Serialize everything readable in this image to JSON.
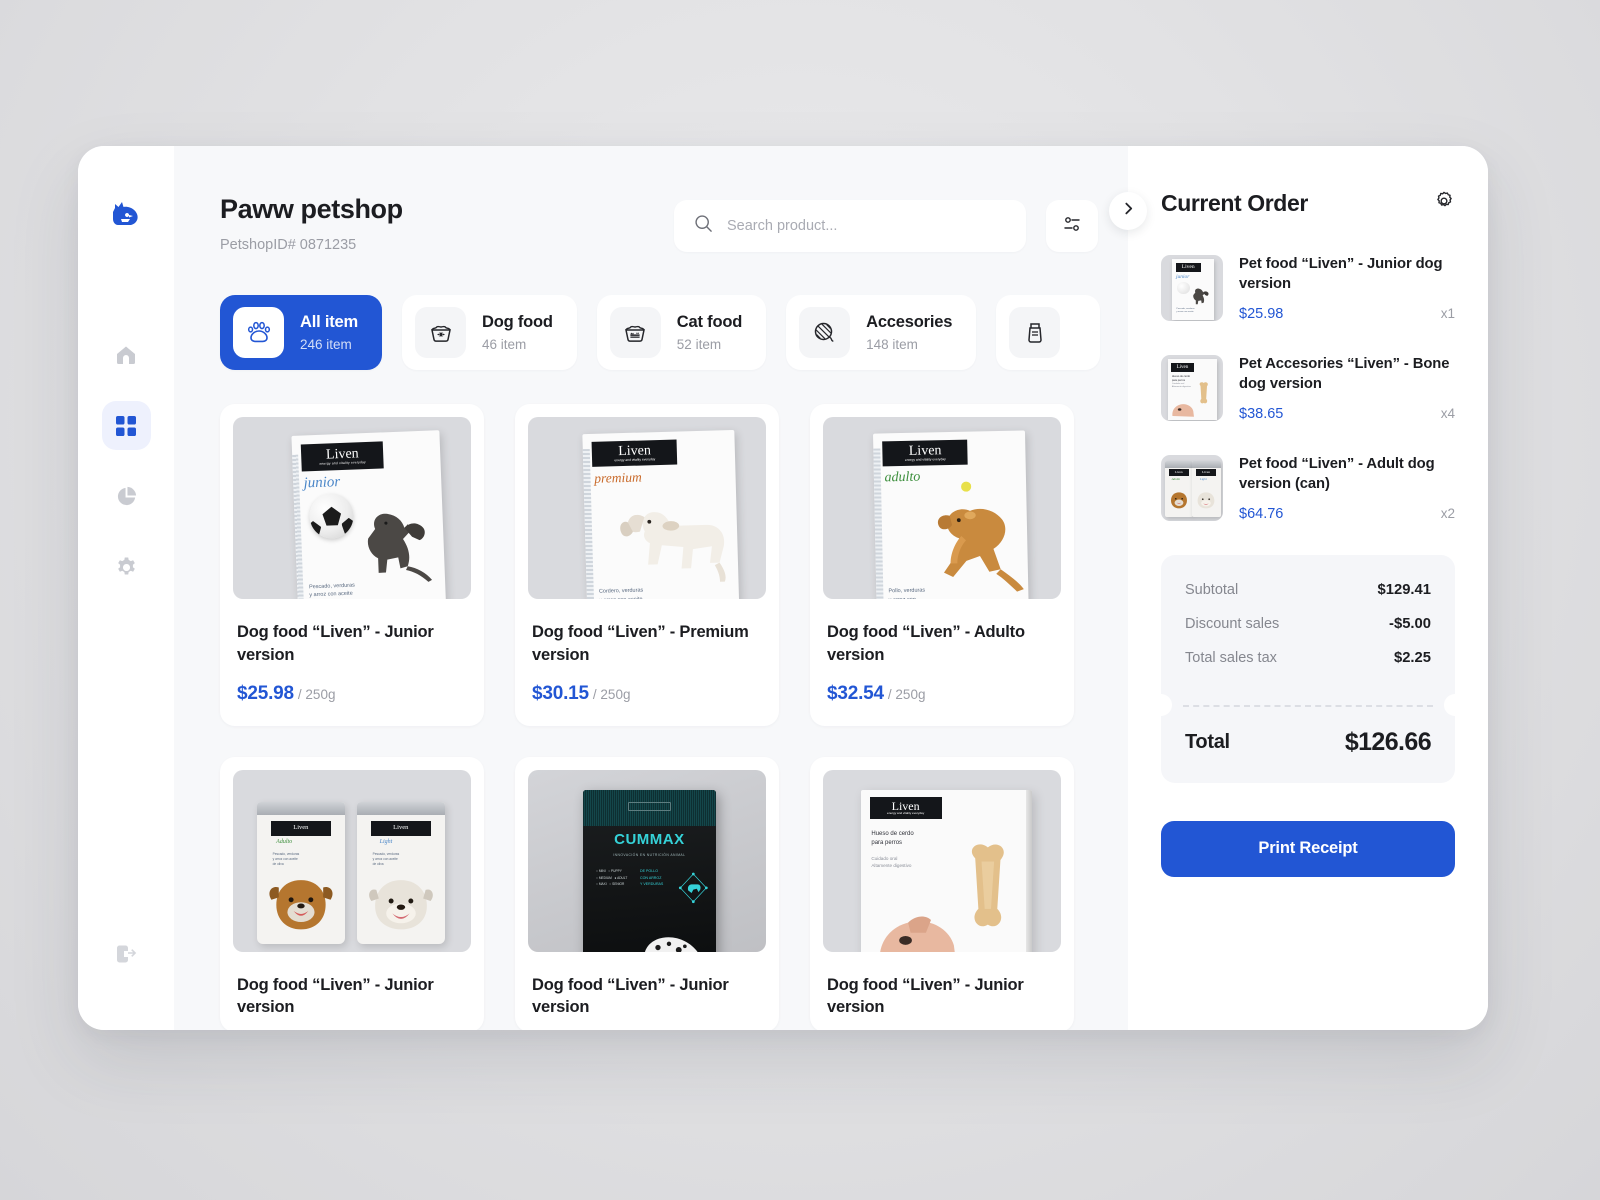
{
  "app": {
    "logo_icon": "dog-head-logo",
    "accent_color": "#2256d4",
    "background_color": "#f7f8fa"
  },
  "sidebar": {
    "items": [
      {
        "name": "home",
        "icon": "home-icon",
        "active": false
      },
      {
        "name": "dashboard",
        "icon": "grid-icon",
        "active": true
      },
      {
        "name": "analytics",
        "icon": "pie-chart-icon",
        "active": false
      },
      {
        "name": "settings",
        "icon": "gear-icon",
        "active": false
      }
    ],
    "logout": {
      "name": "logout",
      "icon": "logout-icon"
    }
  },
  "header": {
    "title": "Paww petshop",
    "subtitle": "PetshopID# 0871235",
    "search": {
      "placeholder": "Search product...",
      "value": "",
      "icon": "search-icon"
    },
    "filter_button": {
      "icon": "filter-sliders-icon"
    }
  },
  "categories": [
    {
      "label": "All item",
      "count": "246 item",
      "icon": "paw-icon",
      "active": true
    },
    {
      "label": "Dog food",
      "count": "46 item",
      "icon": "dog-bowl-icon",
      "active": false
    },
    {
      "label": "Cat food",
      "count": "52 item",
      "icon": "cat-bowl-icon",
      "active": false
    },
    {
      "label": "Accesories",
      "count": "148 item",
      "icon": "yarn-ball-icon",
      "active": false
    },
    {
      "label": "",
      "count": "",
      "icon": "grooming-bottle-icon",
      "active": false
    }
  ],
  "products": [
    {
      "title": "Dog food “Liven” - Junior version",
      "price": "$25.98",
      "unit": "/ 250g",
      "art": "liven-junior-bag"
    },
    {
      "title": "Dog food “Liven” - Premium version",
      "price": "$30.15",
      "unit": "/ 250g",
      "art": "liven-premium-bag"
    },
    {
      "title": "Dog food “Liven” - Adulto version",
      "price": "$32.54",
      "unit": "/ 250g",
      "art": "liven-adulto-bag"
    },
    {
      "title": "Dog food “Liven” - Junior version",
      "price": "",
      "unit": "",
      "art": "liven-cans-pair"
    },
    {
      "title": "Dog food “Liven” - Junior version",
      "price": "",
      "unit": "",
      "art": "cummax-pouch"
    },
    {
      "title": "Dog food “Liven” - Junior version",
      "price": "",
      "unit": "",
      "art": "liven-bone-pack"
    }
  ],
  "order": {
    "title": "Current Order",
    "settings_icon": "gear-icon",
    "collapse_icon": "chevron-right-icon",
    "items": [
      {
        "name": "Pet food “Liven” - Junior dog version",
        "price": "$25.98",
        "qty": "x1",
        "art": "liven-junior-bag"
      },
      {
        "name": "Pet Accesories “Liven” - Bone dog version",
        "price": "$38.65",
        "qty": "x4",
        "art": "liven-bone-pack"
      },
      {
        "name": "Pet food “Liven” - Adult dog version (can)",
        "price": "$64.76",
        "qty": "x2",
        "art": "liven-cans-pair"
      }
    ],
    "totals": {
      "rows": [
        {
          "label": "Subtotal",
          "value": "$129.41"
        },
        {
          "label": "Discount sales",
          "value": "-$5.00"
        },
        {
          "label": "Total sales tax",
          "value": "$2.25"
        }
      ],
      "total_label": "Total",
      "total_value": "$126.66"
    },
    "print_label": "Print Receipt"
  }
}
